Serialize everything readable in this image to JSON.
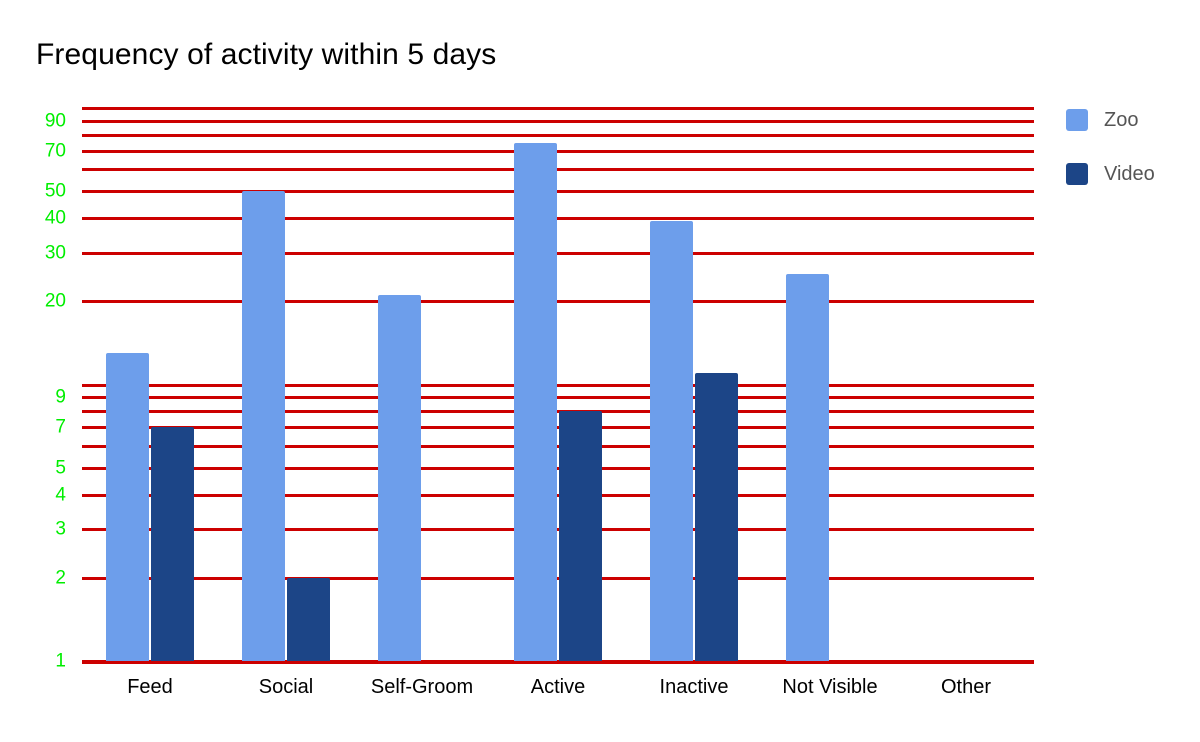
{
  "chart_data": {
    "type": "bar",
    "title": "Frequency of activity within 5 days",
    "xlabel": "",
    "ylabel": "",
    "yscale": "log",
    "ylim": [
      1,
      100
    ],
    "grid": true,
    "legend_position": "right",
    "categories": [
      "Feed",
      "Social",
      "Self-Groom",
      "Active",
      "Inactive",
      "Not Visible",
      "Other"
    ],
    "series": [
      {
        "name": "Zoo",
        "color": "#6d9eeb",
        "values": [
          13,
          50,
          21,
          75,
          39,
          25,
          0
        ]
      },
      {
        "name": "Video",
        "color": "#1c4587",
        "values": [
          7,
          2,
          0,
          8,
          11,
          0,
          0
        ]
      }
    ],
    "y_ticks": [
      {
        "value": 100,
        "label": ""
      },
      {
        "value": 90,
        "label": "90"
      },
      {
        "value": 80,
        "label": ""
      },
      {
        "value": 70,
        "label": "70"
      },
      {
        "value": 60,
        "label": ""
      },
      {
        "value": 50,
        "label": "50"
      },
      {
        "value": 40,
        "label": "40"
      },
      {
        "value": 30,
        "label": "30"
      },
      {
        "value": 20,
        "label": "20"
      },
      {
        "value": 10,
        "label": ""
      },
      {
        "value": 9,
        "label": "9"
      },
      {
        "value": 8,
        "label": ""
      },
      {
        "value": 7,
        "label": "7"
      },
      {
        "value": 6,
        "label": ""
      },
      {
        "value": 5,
        "label": "5"
      },
      {
        "value": 4,
        "label": "4"
      },
      {
        "value": 3,
        "label": "3"
      },
      {
        "value": 2,
        "label": "2"
      },
      {
        "value": 1,
        "label": "1"
      }
    ],
    "colors": {
      "gridline": "#cc0000",
      "y_tick_label": "#00ee00",
      "x_tick_label": "#000000",
      "title": "#000000",
      "legend_label": "#555555",
      "background": "#ffffff"
    }
  }
}
